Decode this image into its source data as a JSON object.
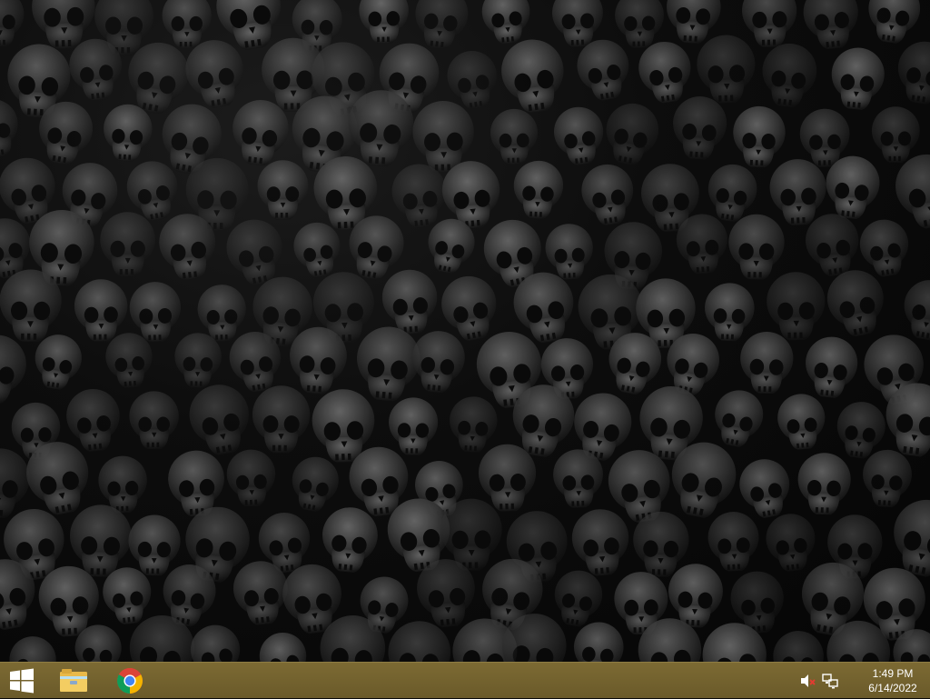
{
  "desktop": {
    "wallpaper": "dark skull pattern wallpaper"
  },
  "taskbar": {
    "color": "#75652f",
    "start_icon": "windows-logo-icon",
    "pinned": [
      {
        "name": "File Explorer",
        "icon": "folder-icon"
      },
      {
        "name": "Google Chrome",
        "icon": "chrome-icon"
      }
    ],
    "tray": {
      "volume_icon": "volume-muted-icon",
      "network_icon": "network-icon"
    },
    "clock": {
      "time": "1:49 PM",
      "date": "6/14/2022"
    }
  },
  "colors": {
    "taskbar": "#75652f",
    "skull_light": "#5a5a5a",
    "skull_dark": "#1a1a1a",
    "chrome_red": "#db4437",
    "chrome_yellow": "#f4b400",
    "chrome_green": "#0f9d58",
    "chrome_blue": "#4285f4"
  }
}
